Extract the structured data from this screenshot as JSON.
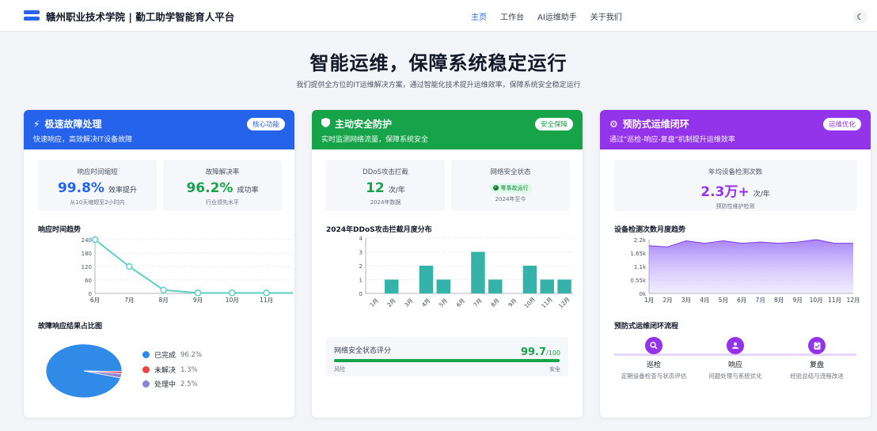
{
  "nav": {
    "brand": "赣州职业技术学院 | 勤工助学智能育人平台",
    "links": [
      "主页",
      "工作台",
      "AI运维助手",
      "关于我们"
    ],
    "theme_icon": "moon-icon"
  },
  "hero": {
    "title": "智能运维，保障系统稳定运行",
    "subtitle": "我们提供全方位的IT运维解决方案，通过智能化技术提升运维效率，保障系统安全稳定运行"
  },
  "colors": {
    "blue": "#2563eb",
    "green": "#16a34a",
    "purple": "#9333ea",
    "teal": "#5dd0c5",
    "teal_bar": "#35b3a8"
  },
  "cards": [
    {
      "title": "极速故障处理",
      "desc": "快速响应，高效解决IT设备故障",
      "badge": "核心功能",
      "icon": "bolt-icon",
      "stats": [
        {
          "label": "响应时间缩短",
          "value": "99.8%",
          "unit": "效率提升",
          "note": "从10天缩短至2小时内"
        },
        {
          "label": "故障解决率",
          "value": "96.2%",
          "unit": "成功率",
          "note": "行业领先水平"
        }
      ],
      "chart_title": "响应时间趋势",
      "pie_title": "故障响应结果占比图",
      "pie_legend": [
        {
          "label": "已完成",
          "value": "96.2%",
          "color": "#2f8ae8"
        },
        {
          "label": "未解决",
          "value": "1.3%",
          "color": "#ef4444"
        },
        {
          "label": "处理中",
          "value": "2.5%",
          "color": "#8b83d6"
        }
      ]
    },
    {
      "title": "主动安全防护",
      "desc": "实时监测网络流量，保障系统安全",
      "badge": "安全保障",
      "icon": "shield-icon",
      "stats": [
        {
          "label": "DDoS攻击拦截",
          "value": "12",
          "unit": "次/年",
          "note": "2024年数据"
        },
        {
          "label": "网络安全状态",
          "tag": "零事故运行",
          "note": "2024年至今"
        }
      ],
      "chart_title": "2024年DDoS攻击拦截月度分布",
      "score": {
        "label": "网络安全状态评分",
        "value": "99.7",
        "max": "/100",
        "fraction": 0.997,
        "low": "风险",
        "high": "安全"
      }
    },
    {
      "title": "预防式运维闭环",
      "desc": "通过\"巡检-响应-复盘\"机制提升运维效率",
      "badge": "运维优化",
      "icon": "gears-icon",
      "stats": [
        {
          "label": "年均设备检测次数",
          "value": "2.3万+",
          "unit": "次/年",
          "note": "预防性维护检测"
        }
      ],
      "chart_title": "设备检测次数月度趋势",
      "flow_title": "预防式运维闭环流程",
      "flow": [
        {
          "name": "巡检",
          "desc": "定期设备检查与状态评估",
          "icon": "search-icon"
        },
        {
          "name": "响应",
          "desc": "问题处理与系统优化",
          "icon": "hand-icon"
        },
        {
          "name": "复盘",
          "desc": "经验总结与流程改进",
          "icon": "clipboard-icon"
        }
      ]
    }
  ],
  "chart_data": [
    {
      "type": "line",
      "categories": [
        "6月",
        "7月",
        "8月",
        "9月",
        "10月",
        "11月",
        "12月"
      ],
      "values": [
        240,
        120,
        15,
        2,
        2,
        2,
        2
      ],
      "yticks": [
        "0",
        "60",
        "120",
        "180",
        "240"
      ],
      "ylim": [
        0,
        240
      ],
      "grid": true
    },
    {
      "type": "bar",
      "categories": [
        "1月",
        "2月",
        "3月",
        "4月",
        "5月",
        "6月",
        "7月",
        "8月",
        "9月",
        "10月",
        "11月",
        "12月"
      ],
      "values": [
        0,
        1,
        0,
        2,
        1,
        0,
        3,
        1,
        0,
        2,
        1,
        1
      ],
      "yticks": [
        "0",
        "1",
        "2",
        "3",
        "4"
      ],
      "ylim": [
        0,
        4
      ],
      "grid": true
    },
    {
      "type": "area",
      "categories": [
        "1月",
        "2月",
        "3月",
        "4月",
        "5月",
        "6月",
        "7月",
        "8月",
        "9月",
        "10月",
        "11月",
        "12月"
      ],
      "values": [
        1950,
        1900,
        2150,
        2050,
        2150,
        2050,
        2100,
        2050,
        2100,
        2200,
        2050,
        2050
      ],
      "yticks": [
        "0k",
        "0.55k",
        "1.1k",
        "1.65k",
        "2.2k"
      ],
      "ylim": [
        0,
        2200
      ],
      "grid": true
    },
    {
      "type": "pie",
      "categories": [
        "已完成",
        "未解决",
        "处理中"
      ],
      "values": [
        96.2,
        1.3,
        2.5
      ]
    }
  ]
}
